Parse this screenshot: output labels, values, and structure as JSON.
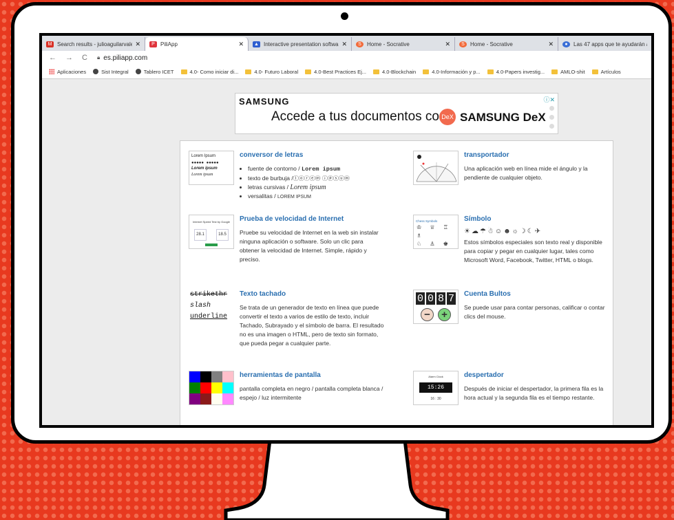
{
  "browser": {
    "tabs": [
      {
        "title": "Search results - julioaguilarvale",
        "icon": "gmail-icon",
        "icon_color": "#d93025"
      },
      {
        "title": "PiliApp",
        "icon": "piliapp-icon",
        "icon_color": "#e0343c"
      },
      {
        "title": "Interactive presentation softwa",
        "icon": "mentimeter-icon",
        "icon_color": "#2f5fd0"
      },
      {
        "title": "Home - Socrative",
        "icon": "socrative-icon",
        "icon_color": "#f26a3a"
      },
      {
        "title": "Home - Socrative",
        "icon": "socrative-icon",
        "icon_color": "#f26a3a"
      },
      {
        "title": "Las 47 apps que te ayudarán a",
        "icon": "app-icon",
        "icon_color": "#3b6fd6"
      }
    ],
    "url": "es.piliapp.com",
    "bookmarks": [
      {
        "label": "Aplicaciones",
        "type": "apps"
      },
      {
        "label": "Sist Integral",
        "type": "globe"
      },
      {
        "label": "Tablero ICET",
        "type": "globe"
      },
      {
        "label": "4.0- Como iniciar di...",
        "type": "folder"
      },
      {
        "label": "4.0- Futuro Laboral",
        "type": "folder"
      },
      {
        "label": "4.0-Best Practices Ej...",
        "type": "folder"
      },
      {
        "label": "4.0-Blockchain",
        "type": "folder"
      },
      {
        "label": "4.0-Información y p...",
        "type": "folder"
      },
      {
        "label": "4.0-Papers investig...",
        "type": "folder"
      },
      {
        "label": "AMLO-shit",
        "type": "folder"
      },
      {
        "label": "Artículos",
        "type": "folder"
      }
    ]
  },
  "ad": {
    "brand": "SAMSUNG",
    "headline": "Accede a tus documentos con",
    "dex_badge": "DeX",
    "product": "SAMSUNG DeX",
    "info": "ⓘ✕"
  },
  "tools": {
    "conversor": {
      "title": "conversor de letras",
      "thumb": [
        "Lorem Ipsum",
        "●●●●● ●●●●●",
        "Lorem ipsum",
        "Lorem ipsum"
      ],
      "items": [
        {
          "label": "fuente de contorno / ",
          "sample": "Lorem ipsum"
        },
        {
          "label": "texto de burbuja /",
          "sample": "ⓛⓞⓡⓔⓜ ⓘⓟⓢⓤⓜ"
        },
        {
          "label": "letras cursivas / ",
          "sample": "Lorem ipsum"
        },
        {
          "label": "versalitas / ",
          "sample": "LOREM IPSUM"
        }
      ]
    },
    "transportador": {
      "title": "transportador",
      "desc": "Una aplicación web en línea mide el ángulo y la pendiente de cualquier objeto."
    },
    "velocidad": {
      "title": "Prueba de velocidad de Internet",
      "desc": "Pruebe su velocidad de Internet en la web sin instalar ninguna aplicación o software. Solo un clic para obtener la velocidad de Internet. Simple, rápido y preciso.",
      "thumb_title": "Internet Speed Test by Google",
      "thumb_down": "28.1",
      "thumb_up": "18.5"
    },
    "simbolo": {
      "title": "Símbolo",
      "thumb_title": "Chess Symbols",
      "thumb_rows": [
        "♔ ♕ ♖ ♗",
        "♘ ♙ ♚ ♛",
        "♜ ♝ ♞ ♟"
      ],
      "symbols": "☀☁☂☃☺☻☼☽☾✈",
      "desc": "Estos símbolos especiales son texto real y disponible para copiar y pegar en cualquier lugar, tales como Microsoft Word, Facebook, Twitter, HTML o blogs."
    },
    "tachado": {
      "title": "Texto tachado",
      "thumb": [
        "strikethr",
        "slash",
        "underline"
      ],
      "desc": "Se trata de un generador de texto en línea que puede convertir el texto a varios de estilo de texto, incluir Tachado, Subrayado y el símbolo de barra. El resultado no es una imagen o HTML, pero de texto sin formato, que pueda pegar a cualquier parte."
    },
    "bultos": {
      "title": "Cuenta Bultos",
      "digits": [
        "0",
        "0",
        "8",
        "7"
      ],
      "minus": "−",
      "plus": "+",
      "desc": "Se puede usar para contar personas, calificar o contar clics del mouse."
    },
    "pantalla": {
      "title": "herramientas de pantalla",
      "colors": [
        "#0000ff",
        "#000000",
        "#808080",
        "#ffc0cb",
        "#008000",
        "#ff0000",
        "#ffff00",
        "#00ffff",
        "#800080",
        "#8b1a1a",
        "#fffff0",
        "#ff88ff"
      ],
      "desc": "pantalla completa en negro / pantalla completa blanca / espejo / luz intermitente"
    },
    "despertador": {
      "title": "despertador",
      "thumb_title": "Alarm Clock",
      "thumb_time": "15:26",
      "thumb_alarm": "16 : 30",
      "desc": "Después de iniciar el despertador, la primera fila es la hora actual y la segunda fila es el tiempo restante."
    }
  }
}
